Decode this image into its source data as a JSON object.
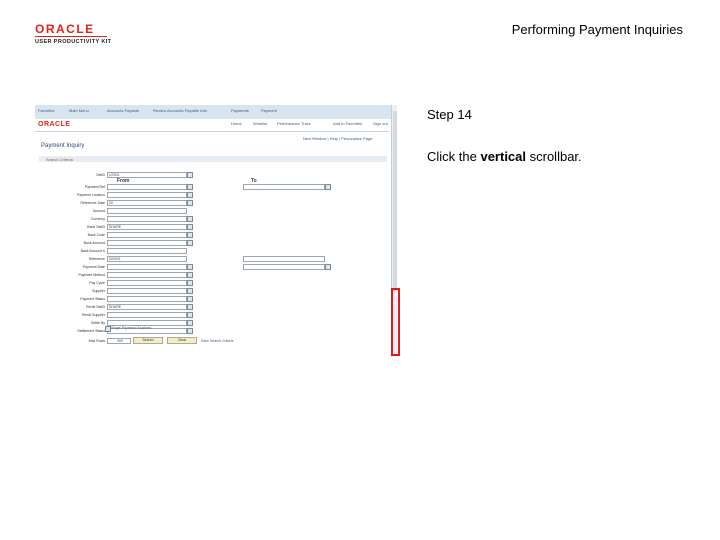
{
  "header": {
    "brand": "ORACLE",
    "brand_sub": "USER PRODUCTIVITY KIT",
    "doc_title": "Performing Payment Inquiries"
  },
  "step": {
    "title": "Step 14",
    "instruction_prefix": "Click the ",
    "instruction_bold": "vertical",
    "instruction_suffix": " scrollbar."
  },
  "screenshot": {
    "topbar_items": [
      "Favorites",
      "Main Menu",
      "Accounts Payable",
      "Review Accounts Payable Info",
      "Payments",
      "Payment"
    ],
    "brand": "ORACLE",
    "nav_links": [
      "Home",
      "Worklist",
      "Performance Trace",
      "Add to Favorites",
      "Sign out"
    ],
    "page_links": "New Window | Help | Personalize Page",
    "page_title": "Payment Inquiry",
    "criteria_label": "Search Criteria",
    "from_header": "From",
    "to_header": "To",
    "fields": [
      {
        "label": "SetID",
        "value": "US001"
      },
      {
        "label": "Payment Ref",
        "value": ""
      },
      {
        "label": "Payment Location",
        "value": ""
      },
      {
        "label": "Reference Date",
        "value": "20"
      },
      {
        "label": "Amount",
        "value": ""
      },
      {
        "label": "Currency",
        "value": ""
      },
      {
        "label": "Bank SetID",
        "value": "SHARE"
      },
      {
        "label": "Bank Code",
        "value": ""
      },
      {
        "label": "Bank Account",
        "value": ""
      },
      {
        "label": "Bank Account #",
        "value": ""
      },
      {
        "label": "Reference",
        "value": "000001"
      },
      {
        "label": "Payment Date",
        "value": ""
      },
      {
        "label": "Payment Method",
        "value": ""
      },
      {
        "label": "Pay Cycle",
        "value": ""
      },
      {
        "label": "Supplier",
        "value": ""
      },
      {
        "label": "Payment Status",
        "value": ""
      },
      {
        "label": "Remit SetID",
        "value": "SHARE"
      },
      {
        "label": "Remit Supplier",
        "value": ""
      },
      {
        "label": "Settle By",
        "value": ""
      },
      {
        "label": "Settlement Status",
        "value": ""
      }
    ],
    "checkbox_label": "Single Payment Vouchers",
    "max_rows_label": "Max Rows",
    "max_rows_value": "300",
    "search_button": "Search",
    "clear_button": "Clear",
    "save_criteria": "Save Search Criteria"
  },
  "colors": {
    "highlight": "#e0191f",
    "brand": "#e2231a"
  }
}
